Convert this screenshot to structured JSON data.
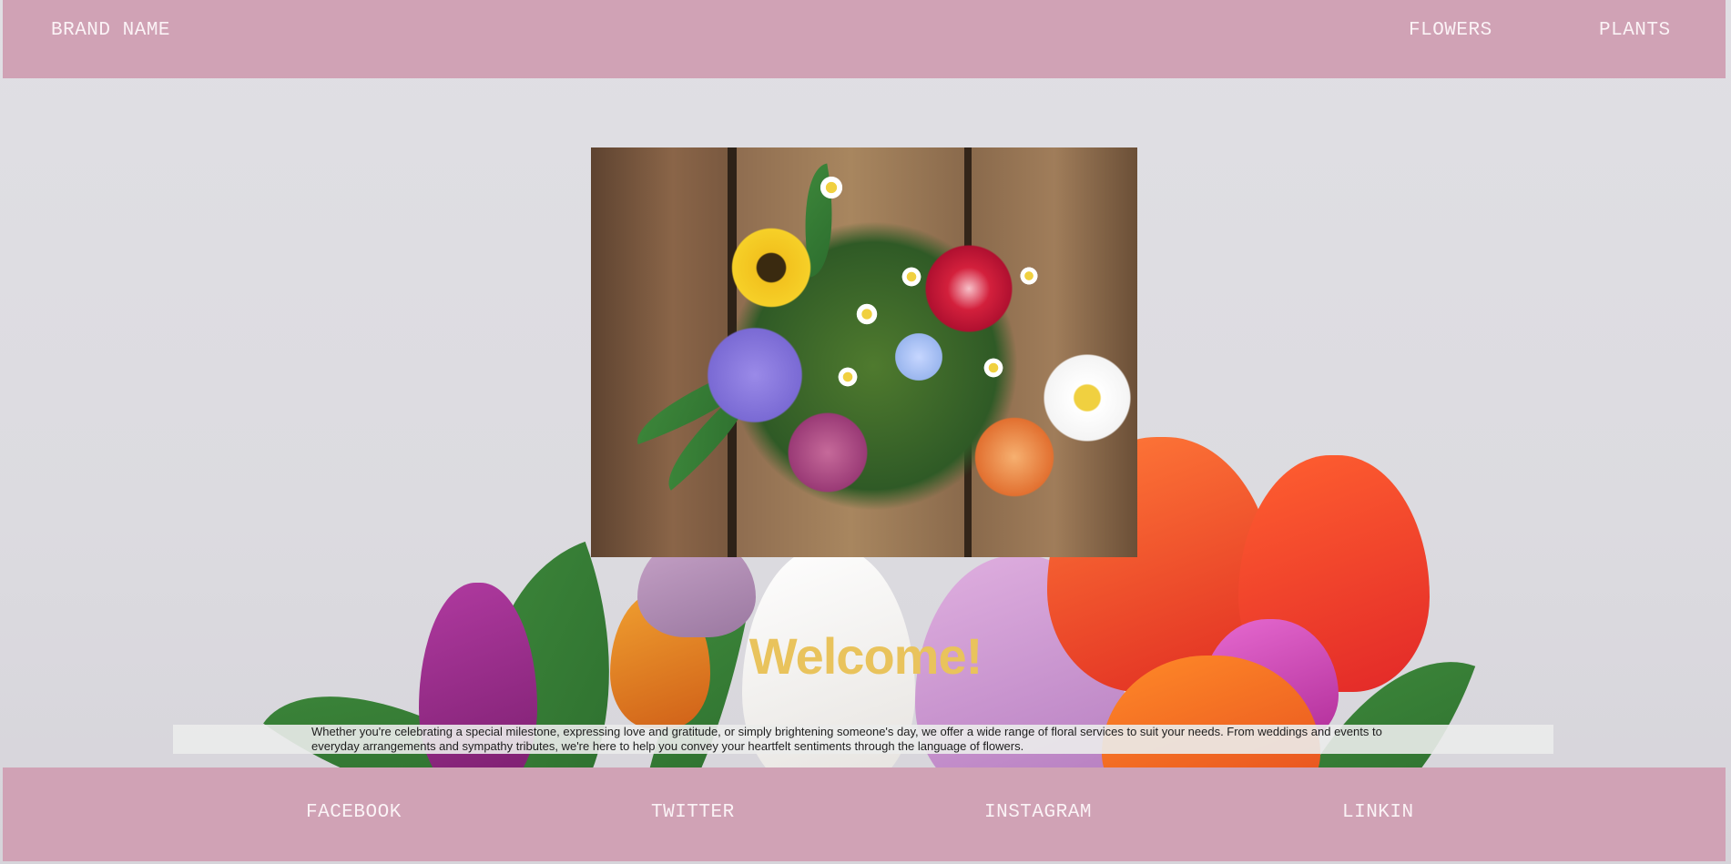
{
  "header": {
    "brand": "BRAND NAME",
    "nav": [
      "FLOWERS",
      "PLANTS"
    ]
  },
  "hero": {
    "image": "flower-bouquet-image",
    "title": "Welcome!",
    "description": "Whether you're celebrating a special milestone, expressing love and gratitude, or simply brightening someone's day, we offer a wide range of floral services to suit your needs. From weddings and events to everyday arrangements and sympathy tributes, we're here to help you convey your heartfelt sentiments through the language of flowers."
  },
  "footer": {
    "links": [
      "FACEBOOK",
      "TWITTER",
      "INSTAGRAM",
      "LINKIN"
    ]
  },
  "colors": {
    "bar": "#d0a2b5",
    "title": "#e9c35c",
    "background": "#e4e3e7"
  }
}
